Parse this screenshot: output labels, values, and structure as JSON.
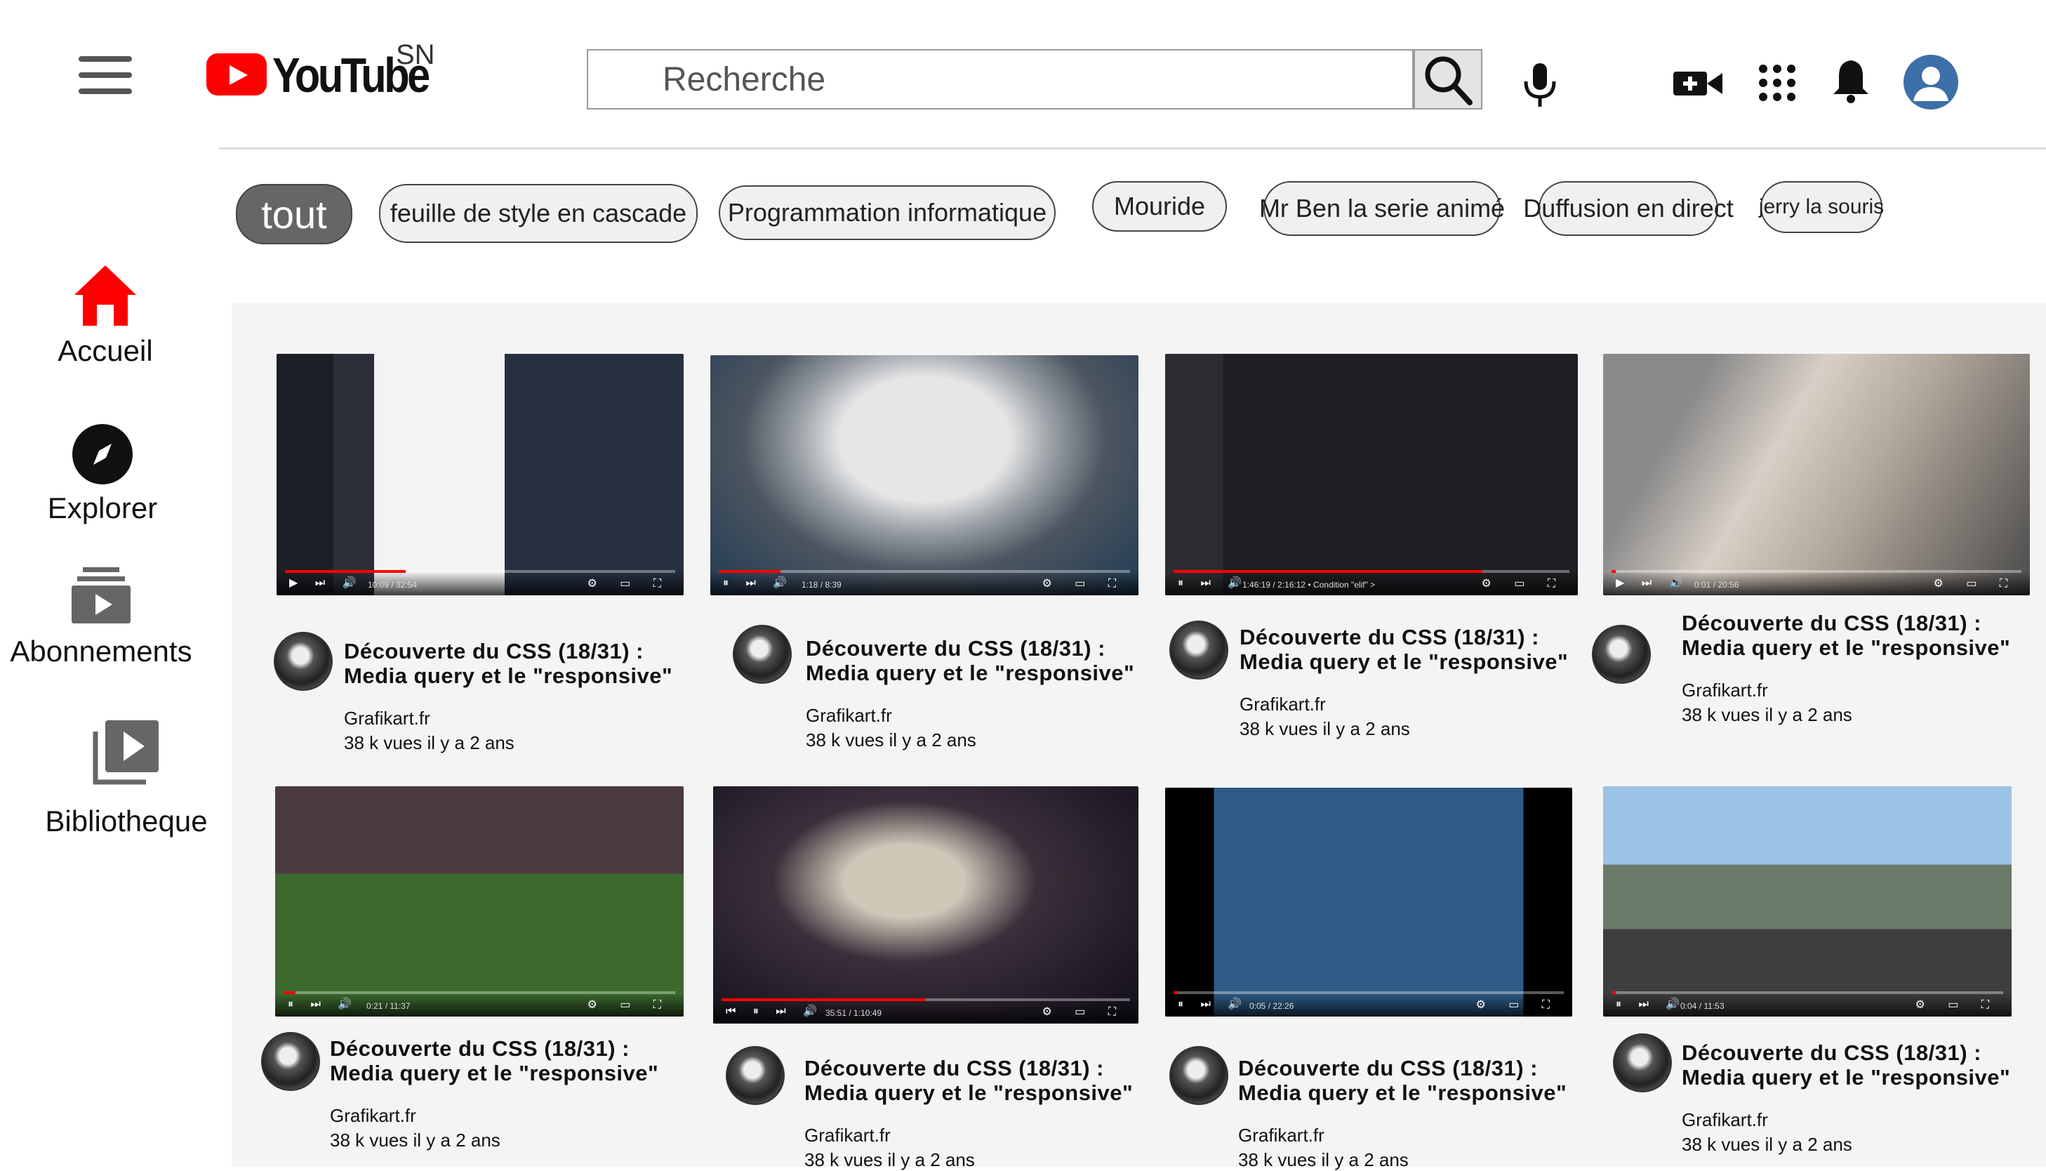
{
  "header": {
    "logo_text": "YouTube",
    "country_code": "SN",
    "search_placeholder": "Recherche"
  },
  "chips": [
    "tout",
    "feuille de style en cascade",
    "Programmation informatique",
    "Mouride",
    "Mr Ben la serie animé",
    "Duffusion en direct",
    "jerry la souris"
  ],
  "sidebar": {
    "items": [
      {
        "label": "Accueil",
        "icon": "home-icon"
      },
      {
        "label": "Explorer",
        "icon": "compass-icon"
      },
      {
        "label": "Abonnements",
        "icon": "subscriptions-icon"
      },
      {
        "label": "Bibliotheque",
        "icon": "library-icon"
      }
    ]
  },
  "colors": {
    "accent": "#ff0000",
    "chip_active": "#666666"
  },
  "videos": [
    {
      "title_line1": "Découverte du CSS (18/31) :",
      "title_line2": "Media query et le \"responsive\"",
      "channel": "Grafikart.fr",
      "meta": "38 k vues il y a 2 ans",
      "time": "10:09 / 32:54",
      "progress": 0.31
    },
    {
      "title_line1": "Découverte du CSS (18/31) :",
      "title_line2": "Media query et le \"responsive\"",
      "channel": "Grafikart.fr",
      "meta": "38 k vues il y a 2 ans",
      "time": "1:18 / 8:39",
      "progress": 0.15
    },
    {
      "title_line1": "Découverte du CSS (18/31) :",
      "title_line2": "Media query et le \"responsive\"",
      "channel": "Grafikart.fr",
      "meta": "38 k vues il y a 2 ans",
      "time": "1:46:19 / 2:16:12 • Condition \"elif\" >",
      "progress": 0.78
    },
    {
      "title_line1": "Découverte du CSS (18/31) :",
      "title_line2": "Media query et le \"responsive\"",
      "channel": "Grafikart.fr",
      "meta": "38 k vues il y a 2 ans",
      "time": "0:01 / 20:56",
      "progress": 0.01
    },
    {
      "title_line1": "Découverte du CSS (18/31) :",
      "title_line2": "Media query et le \"responsive\"",
      "channel": "Grafikart.fr",
      "meta": "38 k vues il y a 2 ans",
      "time": "0:21 / 11:37",
      "progress": 0.03
    },
    {
      "title_line1": "Découverte du CSS (18/31) :",
      "title_line2": "Media query et le \"responsive\"",
      "channel": "Grafikart.fr",
      "meta": "38 k vues il y a 2 ans",
      "time": "35:51 / 1:10:49",
      "progress": 0.5
    },
    {
      "title_line1": "Découverte du CSS (18/31) :",
      "title_line2": "Media query et le \"responsive\"",
      "channel": "Grafikart.fr",
      "meta": "38 k vues il y a 2 ans",
      "time": "0:05 / 22:26",
      "progress": 0.01
    },
    {
      "title_line1": "Découverte du CSS (18/31) :",
      "title_line2": "Media query et le \"responsive\"",
      "channel": "Grafikart.fr",
      "meta": "38 k vues il y a 2 ans",
      "time": "0:04 / 11:53",
      "progress": 0.01
    }
  ]
}
